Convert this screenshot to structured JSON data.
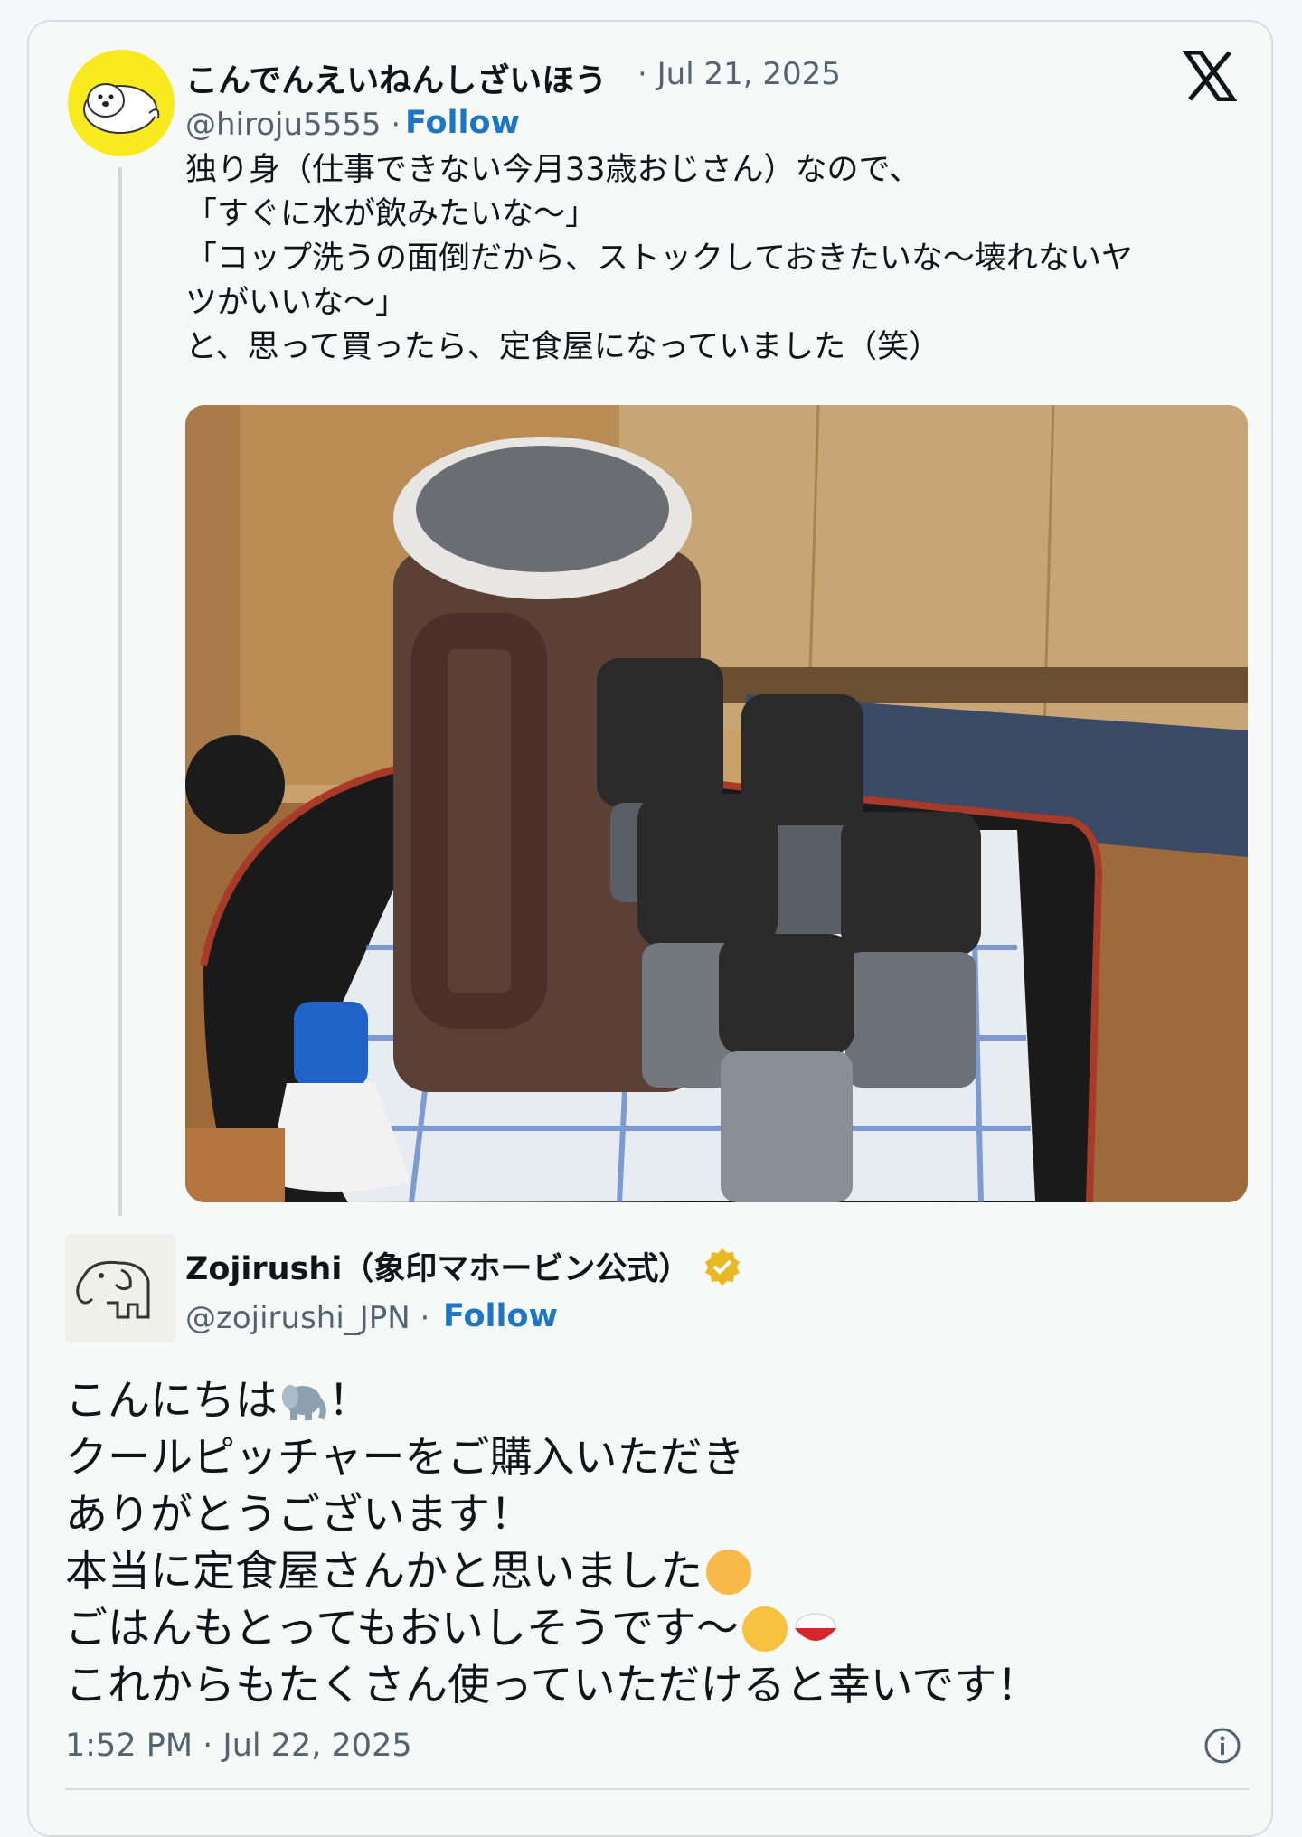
{
  "tweet": {
    "author_name": "こんでんえいねんしざいほう",
    "date": "· Jul 21, 2025",
    "handle": "@hiroju5555 ·",
    "follow_label": "Follow",
    "lines": [
      "独り身（仕事できない今月33歳おじさん）なので、",
      "「すぐに水が飲みたいな〜」",
      "「コップ洗うの面倒だから、ストックしておきたいな〜壊れないヤ",
      "ツがいいな〜」",
      "と、思って買ったら、定食屋になっていました（笑）"
    ]
  },
  "reply": {
    "author_name": "Zojirushi（象印マホービン公式）",
    "handle": "@zojirushi_JPN ·",
    "follow_label": "Follow",
    "lines": [
      "こんにちは",
      "！",
      "クールピッチャーをご購入いただき",
      "ありがとうございます！",
      "本当に定食屋さんかと思いました",
      "ごはんもとってもおいしそうです〜",
      "これからもたくさん使っていただけると幸いです！"
    ],
    "timestamp": "1:52 PM · Jul 22, 2025"
  },
  "icons": [
    "x-logo-icon",
    "verified-badge-icon",
    "elephant-emoji-icon",
    "smiling-hand-over-mouth-emoji-icon",
    "yum-face-emoji-icon",
    "rice-bowl-emoji-icon",
    "info-icon"
  ],
  "colors": {
    "follow_link": "#1d76c5",
    "secondary_text": "#536471",
    "avatar_bg": "#f8ea1f",
    "verified_badge": "#e8b923"
  }
}
